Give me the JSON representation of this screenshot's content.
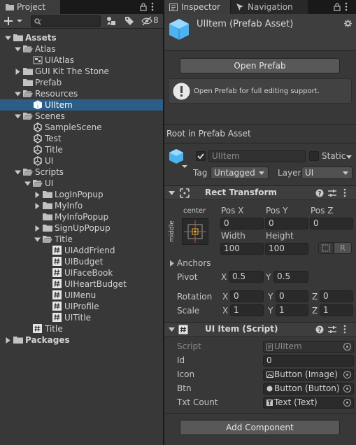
{
  "project": {
    "tab_label": "Project",
    "hidden_count": "8",
    "tree": [
      {
        "label": "Assets",
        "depth": 0,
        "icon": "folder",
        "expanded": true,
        "bold": true
      },
      {
        "label": "Atlas",
        "depth": 1,
        "icon": "folder-open",
        "expanded": true
      },
      {
        "label": "UIAtlas",
        "depth": 2,
        "icon": "sprite-atlas",
        "leaf": true
      },
      {
        "label": "GUI Kit The Stone",
        "depth": 1,
        "icon": "folder",
        "expanded": false
      },
      {
        "label": "Prefab",
        "depth": 1,
        "icon": "folder",
        "leaf": true
      },
      {
        "label": "Resources",
        "depth": 1,
        "icon": "folder-open",
        "expanded": true
      },
      {
        "label": "UIItem",
        "depth": 2,
        "icon": "prefab-cube",
        "leaf": true,
        "selected": true
      },
      {
        "label": "Scenes",
        "depth": 1,
        "icon": "folder-open",
        "expanded": true
      },
      {
        "label": "SampleScene",
        "depth": 2,
        "icon": "unity-scene",
        "leaf": true
      },
      {
        "label": "Test",
        "depth": 2,
        "icon": "unity-scene",
        "leaf": true
      },
      {
        "label": "Title",
        "depth": 2,
        "icon": "unity-scene",
        "leaf": true
      },
      {
        "label": "UI",
        "depth": 2,
        "icon": "unity-scene",
        "leaf": true
      },
      {
        "label": "Scripts",
        "depth": 1,
        "icon": "folder-open",
        "expanded": true
      },
      {
        "label": "UI",
        "depth": 2,
        "icon": "folder-open",
        "expanded": true
      },
      {
        "label": "LogInPopup",
        "depth": 3,
        "icon": "folder",
        "expanded": false
      },
      {
        "label": "MyInfo",
        "depth": 3,
        "icon": "folder",
        "expanded": false
      },
      {
        "label": "MyInfoPopup",
        "depth": 3,
        "icon": "folder",
        "leaf": true
      },
      {
        "label": "SignUpPopup",
        "depth": 3,
        "icon": "folder",
        "expanded": false
      },
      {
        "label": "Title",
        "depth": 3,
        "icon": "folder-open",
        "expanded": true
      },
      {
        "label": "UIAddFriend",
        "depth": 4,
        "icon": "csharp-script",
        "leaf": true
      },
      {
        "label": "UIBudget",
        "depth": 4,
        "icon": "csharp-script",
        "leaf": true
      },
      {
        "label": "UIFaceBook",
        "depth": 4,
        "icon": "csharp-script",
        "leaf": true
      },
      {
        "label": "UIHeartBudget",
        "depth": 4,
        "icon": "csharp-script",
        "leaf": true
      },
      {
        "label": "UIMenu",
        "depth": 4,
        "icon": "csharp-script",
        "leaf": true
      },
      {
        "label": "UIProfile",
        "depth": 4,
        "icon": "csharp-script",
        "leaf": true
      },
      {
        "label": "UITitle",
        "depth": 4,
        "icon": "csharp-script",
        "leaf": true
      },
      {
        "label": "Title",
        "depth": 2,
        "icon": "csharp-script",
        "leaf": true
      },
      {
        "label": "Packages",
        "depth": 0,
        "icon": "folder",
        "expanded": false,
        "bold": true
      }
    ]
  },
  "inspector": {
    "tab_label": "Inspector",
    "nav_tab_label": "Navigation",
    "asset_title": "UIItem (Prefab Asset)",
    "open_prefab_label": "Open Prefab",
    "help_text": "Open Prefab for full editing support.",
    "root_label": "Root in Prefab Asset",
    "object_name": "UIItem",
    "static_label": "Static",
    "tag_label": "Tag",
    "tag_value": "Untagged",
    "layer_label": "Layer",
    "layer_value": "UI",
    "rect_transform": {
      "title": "Rect Transform",
      "anchor_h": "center",
      "anchor_v": "middle",
      "pos_x_label": "Pos X",
      "pos_y_label": "Pos Y",
      "pos_z_label": "Pos Z",
      "pos_x": "0",
      "pos_y": "0",
      "pos_z": "0",
      "width_label": "Width",
      "height_label": "Height",
      "width": "100",
      "height": "100",
      "r_button": "R",
      "anchors_label": "Anchors",
      "pivot_label": "Pivot",
      "pivot_x": "0.5",
      "pivot_y": "0.5",
      "rotation_label": "Rotation",
      "rot_x": "0",
      "rot_y": "0",
      "rot_z": "0",
      "scale_label": "Scale",
      "scale_x": "1",
      "scale_y": "1",
      "scale_z": "1",
      "x": "X",
      "y": "Y",
      "z": "Z"
    },
    "script_comp": {
      "title": "UI Item (Script)",
      "fields": [
        {
          "label": "Script",
          "value": "UIItem",
          "dim": true,
          "icon": "script-icon"
        },
        {
          "label": "Id",
          "value": "0",
          "plain": true
        },
        {
          "label": "Icon",
          "value": "Button (Image)",
          "icon": "image-icon"
        },
        {
          "label": "Btn",
          "value": "Button (Button)",
          "icon": "button-icon"
        },
        {
          "label": "Txt Count",
          "value": "Text (Text)",
          "icon": "text-icon"
        }
      ]
    },
    "add_component_label": "Add Component"
  },
  "colors": {
    "panel": "#383838",
    "selection": "#2c5d87",
    "folder": "#c2c2c2",
    "prefab_blue": "#4cb3f0"
  }
}
